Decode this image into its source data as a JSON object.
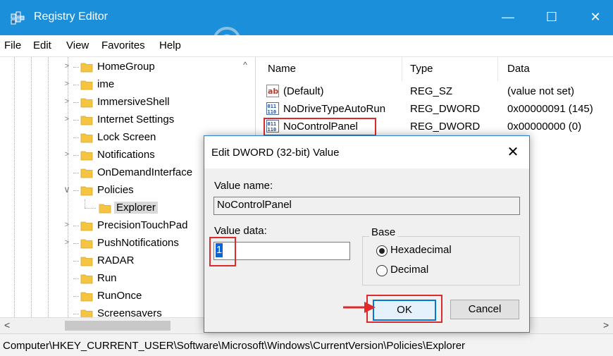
{
  "window": {
    "title": "Registry Editor",
    "minimize": "—",
    "maximize": "☐",
    "close": "✕"
  },
  "menu": {
    "items": [
      "File",
      "Edit",
      "View",
      "Favorites",
      "Help"
    ]
  },
  "tree": {
    "items": [
      {
        "label": "HomeGroup",
        "state": "collapsed"
      },
      {
        "label": "ime",
        "state": "collapsed"
      },
      {
        "label": "ImmersiveShell",
        "state": "collapsed"
      },
      {
        "label": "Internet Settings",
        "state": "collapsed"
      },
      {
        "label": "Lock Screen",
        "state": "leaf"
      },
      {
        "label": "Notifications",
        "state": "collapsed"
      },
      {
        "label": "OnDemandInterface",
        "state": "leaf"
      },
      {
        "label": "Policies",
        "state": "expanded"
      },
      {
        "label": "Explorer",
        "state": "selected-child"
      },
      {
        "label": "PrecisionTouchPad",
        "state": "collapsed"
      },
      {
        "label": "PushNotifications",
        "state": "collapsed"
      },
      {
        "label": "RADAR",
        "state": "leaf"
      },
      {
        "label": "Run",
        "state": "leaf"
      },
      {
        "label": "RunOnce",
        "state": "leaf"
      },
      {
        "label": "Screensavers",
        "state": "leaf"
      }
    ]
  },
  "list": {
    "columns": [
      "Name",
      "Type",
      "Data"
    ],
    "rows": [
      {
        "name": "(Default)",
        "type": "REG_SZ",
        "data": "(value not set)",
        "icon": "string-value-icon"
      },
      {
        "name": "NoDriveTypeAutoRun",
        "type": "REG_DWORD",
        "data": "0x00000091 (145)",
        "icon": "dword-value-icon"
      },
      {
        "name": "NoControlPanel",
        "type": "REG_DWORD",
        "data": "0x00000000 (0)",
        "icon": "dword-value-icon"
      }
    ]
  },
  "dialog": {
    "title": "Edit DWORD (32-bit) Value",
    "close": "✕",
    "value_name_label": "Value name:",
    "value_name": "NoControlPanel",
    "value_data_label": "Value data:",
    "value_data": "1",
    "base_label": "Base",
    "base_options": [
      {
        "label": "Hexadecimal",
        "selected": true
      },
      {
        "label": "Decimal",
        "selected": false
      }
    ],
    "ok": "OK",
    "cancel": "Cancel"
  },
  "statusbar": {
    "path": "Computer\\HKEY_CURRENT_USER\\Software\\Microsoft\\Windows\\CurrentVersion\\Policies\\Explorer"
  },
  "scroll": {
    "left": "<",
    "right": ">",
    "up": "^"
  },
  "colors": {
    "titlebar": "#1b8fd9",
    "folder": "#f5c542",
    "highlight": "#e0292b",
    "accent": "#0078d7"
  }
}
